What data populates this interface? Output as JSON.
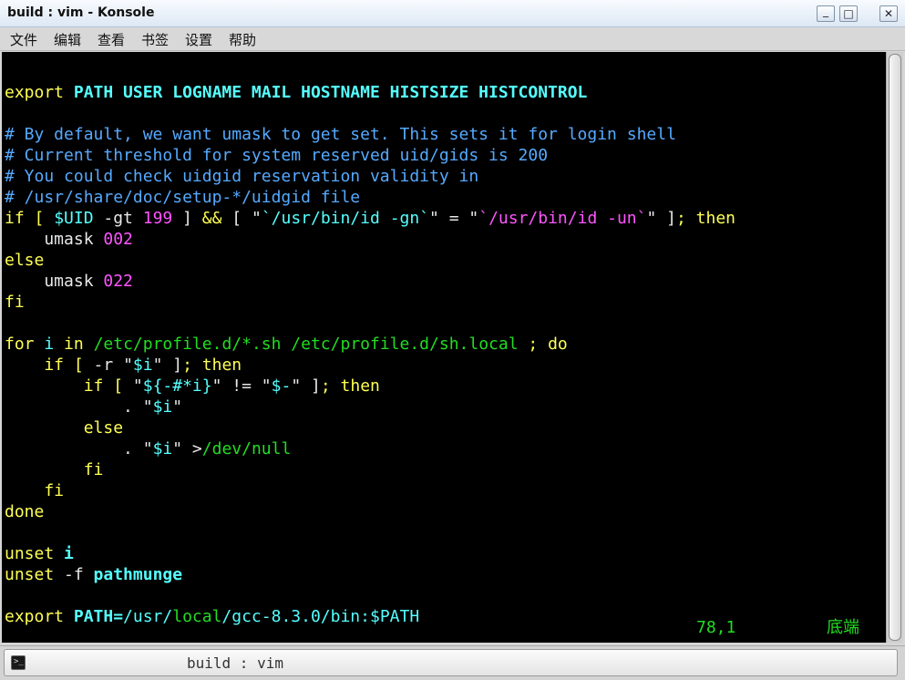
{
  "window": {
    "title": "build : vim - Konsole",
    "minimize_glyph": "_",
    "maximize_glyph": "□",
    "close_glyph": "✕"
  },
  "menu": [
    "文件",
    "编辑",
    "查看",
    "书签",
    "设置",
    "帮助"
  ],
  "editor": {
    "lines": [
      [],
      [
        [
          "export ",
          "yel"
        ],
        [
          "PATH USER LOGNAME MAIL HOSTNAME HISTSIZE HISTCONTROL",
          "cyan"
        ]
      ],
      [],
      [
        [
          "# By default, we want umask to get set. This sets it for login shell",
          "blue"
        ]
      ],
      [
        [
          "# Current threshold for system reserved uid/gids is 200",
          "blue"
        ]
      ],
      [
        [
          "# You could check uidgid reservation validity in",
          "blue"
        ]
      ],
      [
        [
          "# /usr/share/doc/setup-*/uidgid file",
          "blue"
        ]
      ],
      [
        [
          "if [ ",
          "yel"
        ],
        [
          "$UID",
          "cyanN"
        ],
        [
          " -gt ",
          "white"
        ],
        [
          "199",
          "mag"
        ],
        [
          " ] ",
          "white"
        ],
        [
          "&&",
          "yel"
        ],
        [
          " [ \"",
          "white"
        ],
        [
          "`/usr/bin/id -gn`",
          "cyanN"
        ],
        [
          "\" = \"",
          "white"
        ],
        [
          "`/usr/bin/id -un`",
          "mag"
        ],
        [
          "\" ]",
          "white"
        ],
        [
          "; then",
          "yel"
        ]
      ],
      [
        [
          "    umask ",
          "white"
        ],
        [
          "002",
          "mag"
        ]
      ],
      [
        [
          "else",
          "yel"
        ]
      ],
      [
        [
          "    umask ",
          "white"
        ],
        [
          "022",
          "mag"
        ]
      ],
      [
        [
          "fi",
          "yel"
        ]
      ],
      [],
      [
        [
          "for ",
          "yel"
        ],
        [
          "i",
          "cyanN"
        ],
        [
          " in ",
          "yel"
        ],
        [
          "/etc/profile.d/*.sh /etc/profile.d/sh.local",
          "green"
        ],
        [
          " ; do",
          "yel"
        ]
      ],
      [
        [
          "    if [ ",
          "yel"
        ],
        [
          "-r ",
          "white"
        ],
        [
          "\"",
          "white"
        ],
        [
          "$i",
          "cyanN"
        ],
        [
          "\"",
          "white"
        ],
        [
          " ]",
          "white"
        ],
        [
          "; then",
          "yel"
        ]
      ],
      [
        [
          "        if [ ",
          "yel"
        ],
        [
          "\"",
          "white"
        ],
        [
          "${-#*i}",
          "cyanN"
        ],
        [
          "\"",
          "white"
        ],
        [
          " != ",
          "white"
        ],
        [
          "\"",
          "white"
        ],
        [
          "$-",
          "cyanN"
        ],
        [
          "\"",
          "white"
        ],
        [
          " ]",
          "white"
        ],
        [
          "; then",
          "yel"
        ]
      ],
      [
        [
          "            . ",
          "white"
        ],
        [
          "\"",
          "white"
        ],
        [
          "$i",
          "cyanN"
        ],
        [
          "\"",
          "white"
        ]
      ],
      [
        [
          "        else",
          "yel"
        ]
      ],
      [
        [
          "            . ",
          "white"
        ],
        [
          "\"",
          "white"
        ],
        [
          "$i",
          "cyanN"
        ],
        [
          "\"",
          "white"
        ],
        [
          " >",
          "white"
        ],
        [
          "/dev/null",
          "green"
        ]
      ],
      [
        [
          "        fi",
          "yel"
        ]
      ],
      [
        [
          "    fi",
          "yel"
        ]
      ],
      [
        [
          "done",
          "yel"
        ]
      ],
      [],
      [
        [
          "unset ",
          "yel"
        ],
        [
          "i",
          "cyan"
        ]
      ],
      [
        [
          "unset ",
          "yel"
        ],
        [
          "-f ",
          "white"
        ],
        [
          "pathmunge",
          "cyan"
        ]
      ],
      [],
      [
        [
          "export ",
          "yel"
        ],
        [
          "PATH=",
          "cyan"
        ],
        [
          "/usr/",
          "cyanN"
        ],
        [
          "local",
          "green"
        ],
        [
          "/gcc-8.3.0/bin:",
          "cyanN"
        ],
        [
          "$PATH",
          "cyanN"
        ]
      ]
    ],
    "status_position": "78,1",
    "status_scroll": "底端"
  },
  "tab": {
    "label": "build : vim",
    "icon_glyph": ">_"
  },
  "colors": {
    "yel": "#ffff55",
    "cyan": "#55ffff",
    "cyanN": "#55ffff",
    "blue": "#55aaff",
    "mag": "#ff55ff",
    "green": "#22dd22",
    "white": "#e8e8e8"
  }
}
